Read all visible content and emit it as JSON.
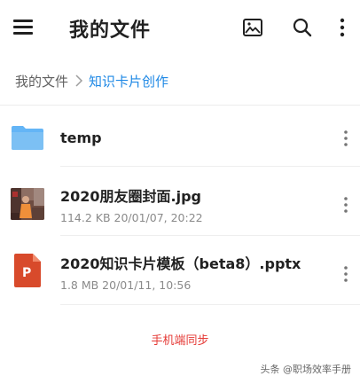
{
  "appbar": {
    "title": "我的文件",
    "icons": [
      "menu-icon",
      "image-icon",
      "search-icon",
      "more-vert-icon"
    ]
  },
  "breadcrumb": {
    "root": "我的文件",
    "current": "知识卡片创作",
    "current_color": "#1e88e5"
  },
  "files": [
    {
      "name": "temp",
      "type": "folder",
      "icon": "folder-icon",
      "icon_color": "#64b5f6"
    },
    {
      "name": "2020朋友圈封面.jpg",
      "type": "image",
      "icon": "image-thumbnail",
      "meta": "114.2 KB 20/01/07, 20:22"
    },
    {
      "name": "2020知识卡片模板（beta8）.pptx",
      "type": "pptx",
      "icon": "pptx-icon",
      "icon_color": "#d84a2b",
      "meta": "1.8 MB 20/01/11, 10:56"
    }
  ],
  "footer_note": "手机端同步",
  "footer_note_color": "#e53935",
  "watermark": "头条 @职场效率手册"
}
